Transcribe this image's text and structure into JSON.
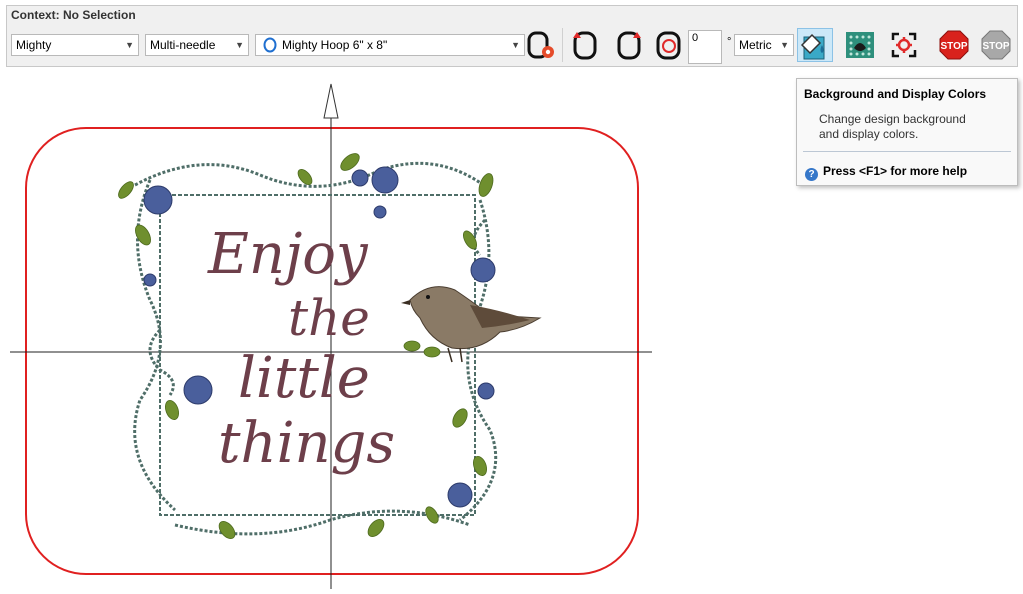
{
  "toolbar": {
    "context_label": "Context: No Selection",
    "machine_brand": "Mighty",
    "machine_type": "Multi-needle",
    "hoop": "Mighty Hoop 6\" x 8\"",
    "rotation_value": "0",
    "rotation_unit": "°",
    "units": "Metric",
    "icons": [
      "hoop-settings-icon",
      "rotate-left-icon",
      "rotate-right-icon",
      "rotate-custom-icon",
      "background-display-colors-icon",
      "stitch-view-icon",
      "center-hoop-icon",
      "stop-icon",
      "stop-disabled-icon"
    ]
  },
  "tooltip": {
    "title": "Background and Display Colors",
    "body_line1": "Change design background",
    "body_line2": "and display colors.",
    "help": "Press <F1> for more help"
  },
  "design": {
    "line1": "Enjoy",
    "line2": "the",
    "line3": "little",
    "line4": "things"
  },
  "colors": {
    "hoop_outline": "#e02020",
    "thread_text": "#6d3f4a",
    "thread_vine": "#4f6e68",
    "thread_leaf": "#6f8f2e",
    "thread_flower": "#4a5f9c",
    "active_button": "#cce8f8"
  }
}
